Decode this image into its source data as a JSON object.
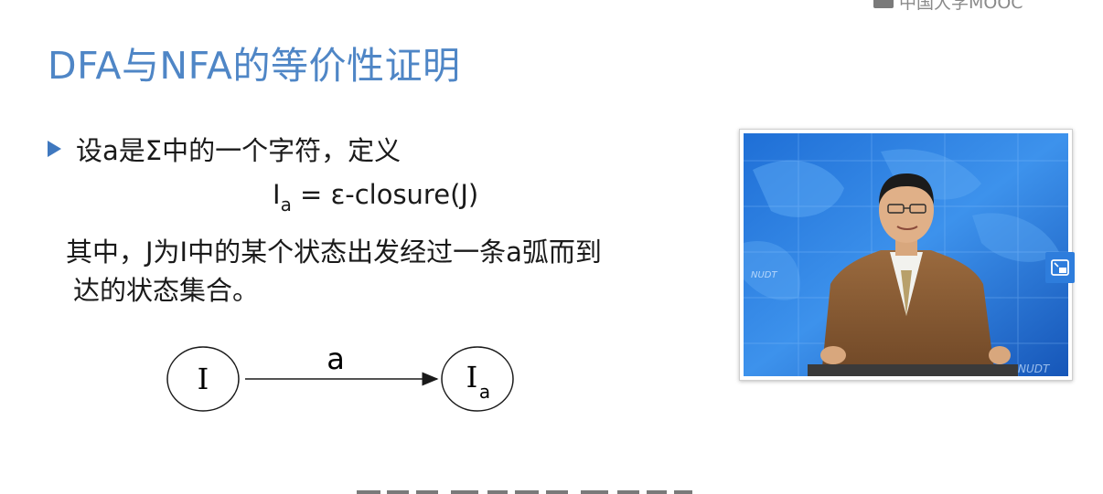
{
  "watermark": {
    "text": "中国大学MOOC"
  },
  "slide": {
    "title": "DFA与NFA的等价性证明",
    "bullet": "设a是Σ中的一个字符，定义",
    "formula": {
      "lhs": "I",
      "lhs_sub": "a",
      "rhs": "= ε-closure(J)"
    },
    "description": {
      "line1": "其中，J为I中的某个状态出发经过一条a弧而到",
      "line2": "达的状态集合。"
    },
    "diagram": {
      "source_state": "I",
      "edge_label": "a",
      "target_state": "I",
      "target_sub": "a"
    }
  },
  "video": {
    "watermark_text": "NUDT"
  },
  "colors": {
    "title": "#4f86c6",
    "bullet": "#3f78bf",
    "button": "#2e7ddc"
  },
  "icons": {
    "side_button": "picture-in-picture-icon"
  }
}
